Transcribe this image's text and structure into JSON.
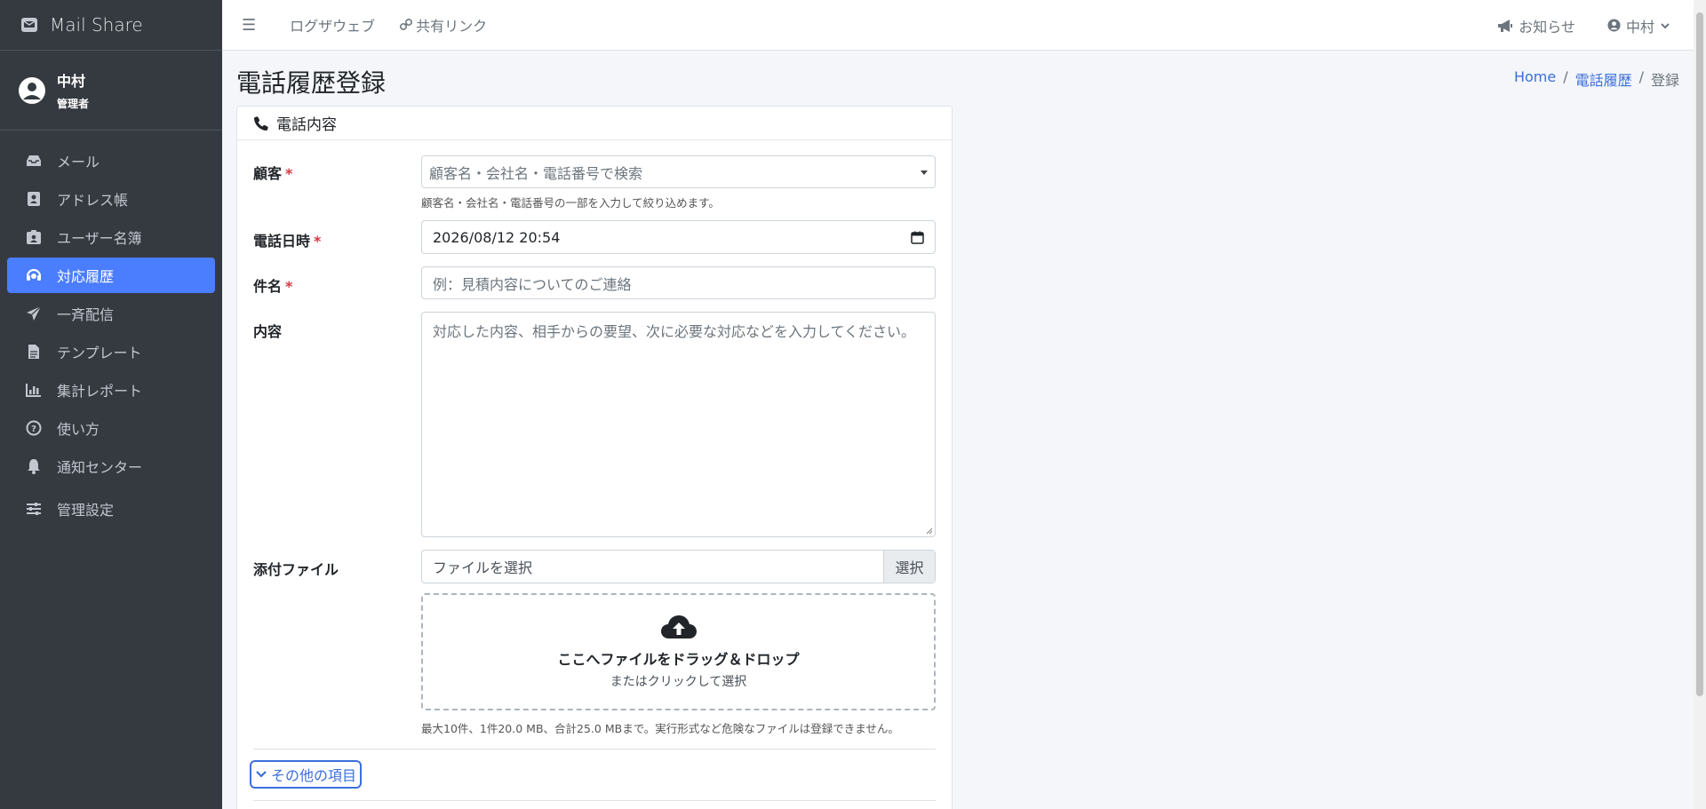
{
  "app": {
    "brand": "Mail Share"
  },
  "user": {
    "name": "中村",
    "role": "管理者"
  },
  "sidebar": {
    "items": [
      {
        "label": "メール",
        "icon": "inbox-icon"
      },
      {
        "label": "アドレス帳",
        "icon": "address-book-icon"
      },
      {
        "label": "ユーザー名簿",
        "icon": "id-badge-icon"
      },
      {
        "label": "対応履歴",
        "icon": "headset-icon",
        "active": true
      },
      {
        "label": "一斉配信",
        "icon": "paper-plane-icon"
      },
      {
        "label": "テンプレート",
        "icon": "file-icon"
      },
      {
        "label": "集計レポート",
        "icon": "chart-icon"
      },
      {
        "label": "使い方",
        "icon": "question-circle-icon"
      },
      {
        "label": "通知センター",
        "icon": "bell-icon"
      },
      {
        "label": "管理設定",
        "icon": "sliders-icon"
      }
    ]
  },
  "topbar": {
    "logout": "ログザウェブ",
    "share_link": "共有リンク",
    "notices": "お知らせ",
    "user": "中村"
  },
  "page": {
    "title": "電話履歴登録",
    "breadcrumb": {
      "home": "Home",
      "parent": "電話履歴",
      "current": "登録"
    }
  },
  "form": {
    "header": "電話内容",
    "customer": {
      "label": "顧客",
      "required": "*",
      "placeholder": "顧客名・会社名・電話番号で検索",
      "help": "顧客名・会社名・電話番号の一部を入力して絞り込めます。"
    },
    "datetime": {
      "label": "電話日時",
      "required": "*",
      "value": "2026/08/12 20:54"
    },
    "subject": {
      "label": "件名",
      "required": "*",
      "placeholder": "例：見積内容についてのご連絡"
    },
    "content": {
      "label": "内容",
      "placeholder": "対応した内容、相手からの要望、次に必要な対応などを入力してください。"
    },
    "attachment": {
      "label": "添付ファイル",
      "placeholder": "ファイルを選択",
      "button": "選択",
      "drop_title": "ここへファイルをドラッグ＆ドロップ",
      "drop_sub": "またはクリックして選択",
      "help": "最大10件、1件20.0 MB、合計25.0 MBまで。実行形式など危険なファイルは登録できません。"
    },
    "more": "その他の項目"
  }
}
